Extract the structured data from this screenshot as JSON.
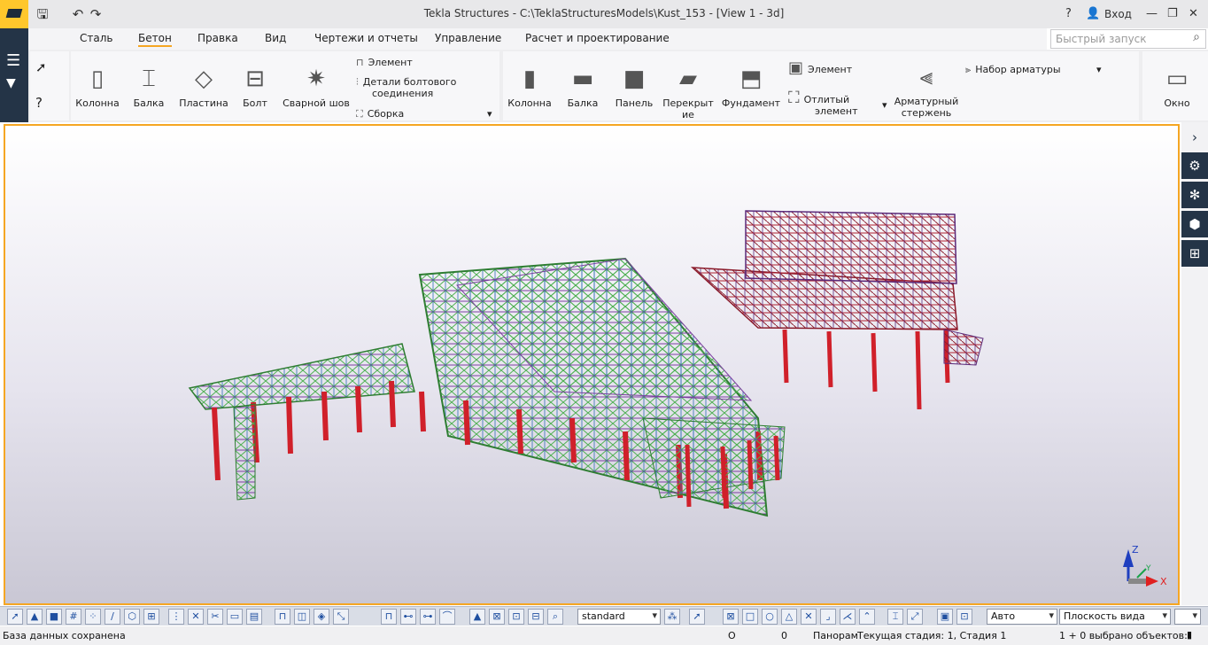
{
  "window": {
    "title": "Tekla Structures - C:\\TeklaStructuresModels\\Kust_153  - [View 1 - 3d]",
    "login": "Вход",
    "help_icon": "?",
    "user_icon": "user-icon"
  },
  "tabs": [
    "Сталь",
    "Бетон",
    "Правка",
    "Вид",
    "Чертежи и отчеты",
    "Управление",
    "Расчет и проектирование"
  ],
  "active_tab": "Бетон",
  "quick_launch": {
    "placeholder": "Быстрый запуск"
  },
  "steel_panel": {
    "column": "Колонна",
    "beam": "Балка",
    "plate": "Пластина",
    "bolt": "Болт",
    "weld": "Сварной шов",
    "element": "Элемент",
    "bolt_details_1": "Детали болтового",
    "bolt_details_2": "соединения",
    "assembly": "Сборка"
  },
  "concrete_panel": {
    "column": "Колонна",
    "beam": "Балка",
    "panel": "Панель",
    "slab_1": "Перекрыт",
    "slab_2": "ие",
    "footing": "Фундамент",
    "element": "Элемент",
    "cast_1": "Отлитый",
    "cast_2": "элемент",
    "rebar_1": "Арматурный",
    "rebar_2": "стержень",
    "rebar_set": "Набор арматуры"
  },
  "window_btn": "Окно",
  "toolbar": {
    "filter": "standard",
    "auto": "Авто",
    "plane": "Плоскость вида"
  },
  "status": {
    "saved": "База данных сохранена",
    "o": "O",
    "zero": "0",
    "pan": "Панорам",
    "phase": "Текущая стадия: 1, Стадия 1",
    "selected": "1 + 0 выбрано объектов:"
  },
  "axes": {
    "z": "Z",
    "y": "Y",
    "x": "X"
  },
  "colors": {
    "accent": "#f5a623",
    "dark": "#243447",
    "steel_red": "#d0202a",
    "steel_green": "#4caf50",
    "steel_purple": "#7b3fa0"
  }
}
